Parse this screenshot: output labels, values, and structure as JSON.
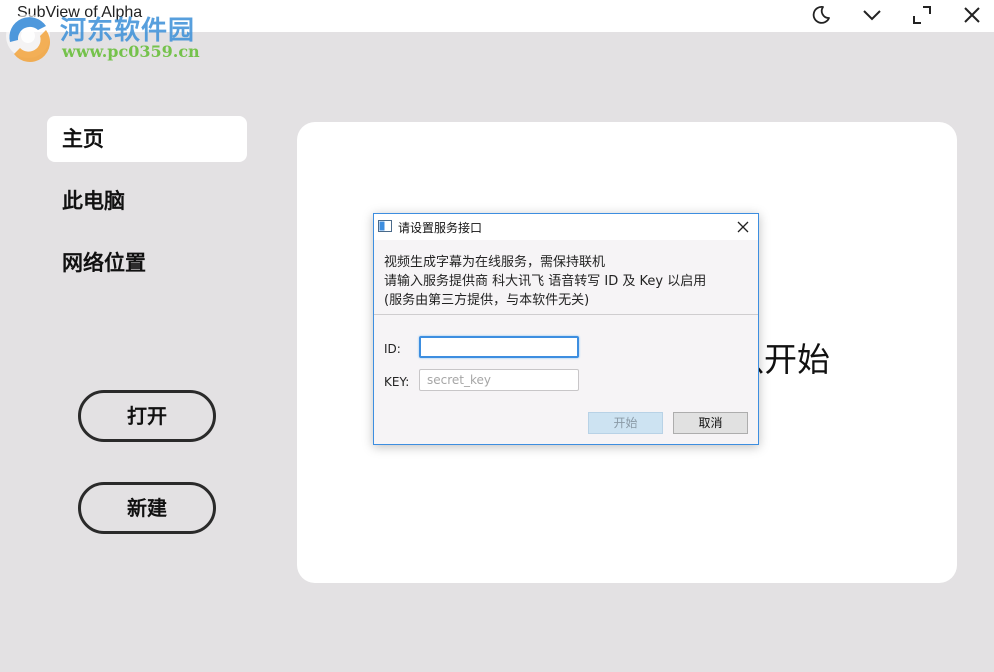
{
  "window": {
    "title": "SubView of Alpha",
    "watermark_name": "河东软件园",
    "watermark_url": "www.pc0359.cn",
    "controls": [
      "theme-icon",
      "collapse-icon",
      "maximize-icon",
      "close-icon"
    ]
  },
  "sidebar": {
    "items": [
      {
        "label": "主页",
        "active": true
      },
      {
        "label": "此电脑",
        "active": false
      },
      {
        "label": "网络位置",
        "active": false
      }
    ],
    "open_label": "打开",
    "new_label": "新建"
  },
  "main": {
    "hint_text": "以开始"
  },
  "dialog": {
    "title": "请设置服务接口",
    "line1": "视频生成字幕为在线服务，需保持联机",
    "line2": "请输入服务提供商 科大讯飞 语音转写 ID 及 Key 以启用",
    "line3": "(服务由第三方提供，与本软件无关)",
    "id_label": "ID:",
    "id_value": "",
    "key_label": "KEY:",
    "key_placeholder": "secret_key",
    "start_label": "开始",
    "cancel_label": "取消"
  },
  "colors": {
    "accent": "#3d8ee0",
    "background": "#e3e1e3",
    "panel": "#ffffff"
  }
}
